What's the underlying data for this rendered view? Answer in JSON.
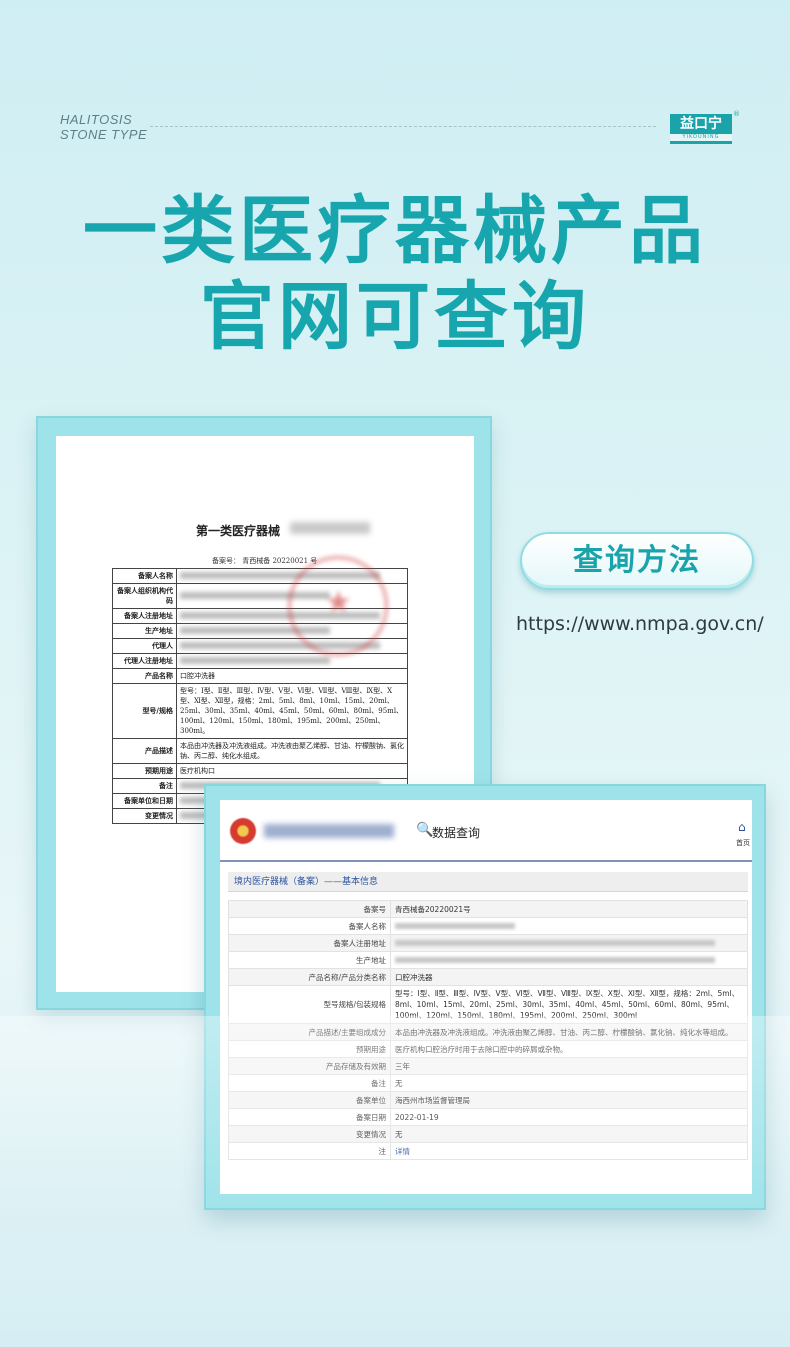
{
  "header": {
    "brand_line1": "HALITOSIS",
    "brand_line2": "STONE TYPE",
    "logo_cn": "益口宁",
    "logo_en": "YIKOUNING",
    "logo_reg": "®"
  },
  "headline": {
    "line1": "一类医疗器械产品",
    "line2": "官网可查询"
  },
  "method": {
    "pill_label": "查询方法",
    "url": "https://www.nmpa.gov.cn/"
  },
  "document": {
    "title": "第一类医疗器械",
    "record_no": "备案号：  青西械备 20220021 号",
    "rows": [
      {
        "label": "备案人名称",
        "value": ""
      },
      {
        "label": "备案人组织机构代码",
        "value": ""
      },
      {
        "label": "备案人注册地址",
        "value": ""
      },
      {
        "label": "生产地址",
        "value": ""
      },
      {
        "label": "代理人",
        "value": ""
      },
      {
        "label": "代理人注册地址",
        "value": ""
      },
      {
        "label": "产品名称",
        "value": "口腔冲洗器"
      },
      {
        "label": "型号/规格",
        "value": "型号：Ⅰ型、Ⅱ型、Ⅲ型、Ⅳ型、Ⅴ型、Ⅵ型、Ⅶ型、Ⅷ型、Ⅸ型、Ⅹ型、Ⅺ型、Ⅻ型，规格：2ml、5ml、8ml、10ml、15ml、20ml、25ml、30ml、35ml、40ml、45ml、50ml、60ml、80ml、95ml、100ml、120ml、150ml、180ml、195ml、200ml、250ml、300ml。"
      },
      {
        "label": "产品描述",
        "value": "本品由冲洗器及冲洗液组成。冲洗液由聚乙烯醇、甘油、柠檬酸钠、氯化钠、丙二醇、纯化水组成。"
      },
      {
        "label": "预期用途",
        "value": "医疗机构口"
      },
      {
        "label": "备注",
        "value": ""
      },
      {
        "label": "备案单位和日期",
        "value": ""
      },
      {
        "label": "变更情况",
        "value": ""
      }
    ]
  },
  "website": {
    "search_title": "数据查询",
    "home_label": "首页",
    "breadcrumb": "境内医疗器械（备案）——基本信息",
    "rows": [
      {
        "label": "备案号",
        "value": "青西械备20220021号"
      },
      {
        "label": "备案人名称",
        "value": ""
      },
      {
        "label": "备案人注册地址",
        "value": ""
      },
      {
        "label": "生产地址",
        "value": ""
      },
      {
        "label": "产品名称/产品分类名称",
        "value": "口腔冲洗器"
      },
      {
        "label": "型号规格/包装规格",
        "value": "型号：Ⅰ型、Ⅱ型、Ⅲ型、Ⅳ型、Ⅴ型、Ⅵ型、Ⅶ型、Ⅷ型、Ⅸ型、Ⅹ型、Ⅺ型、Ⅻ型，规格：2ml、5ml、8ml、10ml、15ml、20ml、25ml、30ml、35ml、40ml、45ml、50ml、60ml、80ml、95ml、100ml、120ml、150ml、180ml、195ml、200ml、250ml、300ml"
      },
      {
        "label": "产品描述/主要组成成分",
        "value": "本品由冲洗器及冲洗液组成。冲洗液由聚乙烯醇、甘油、丙二醇、柠檬酸钠、氯化钠、纯化水等组成。"
      },
      {
        "label": "预期用途",
        "value": "医疗机构口腔治疗时用于去除口腔中的碎屑或杂物。"
      },
      {
        "label": "产品存储及有效期",
        "value": "三年"
      },
      {
        "label": "备注",
        "value": "无"
      },
      {
        "label": "备案单位",
        "value": "海西州市场监督管理局"
      },
      {
        "label": "备案日期",
        "value": "2022-01-19"
      },
      {
        "label": "变更情况",
        "value": "无"
      },
      {
        "label": "注",
        "value": "详情"
      }
    ]
  },
  "colors": {
    "accent": "#17a6ad",
    "frame": "#9fe3ea",
    "link": "#2e55a0"
  }
}
